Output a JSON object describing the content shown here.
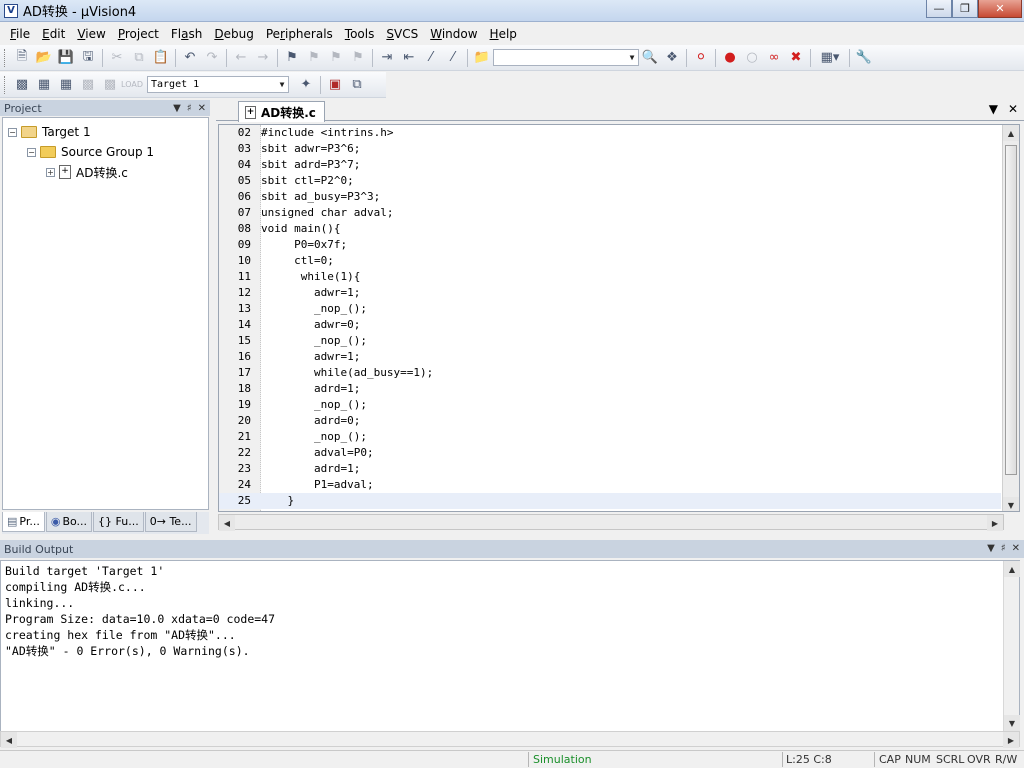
{
  "window": {
    "title": "AD转换 - µVision4",
    "app_icon": "uvision-icon"
  },
  "menu": [
    {
      "label": "File",
      "underline": "F"
    },
    {
      "label": "Edit",
      "underline": "E"
    },
    {
      "label": "View",
      "underline": "V"
    },
    {
      "label": "Project",
      "underline": "P"
    },
    {
      "label": "Flash",
      "underline": "a"
    },
    {
      "label": "Debug",
      "underline": "D"
    },
    {
      "label": "Peripherals",
      "underline": "r"
    },
    {
      "label": "Tools",
      "underline": "T"
    },
    {
      "label": "SVCS",
      "underline": "S"
    },
    {
      "label": "Window",
      "underline": "W"
    },
    {
      "label": "Help",
      "underline": "H"
    }
  ],
  "toolbar2": {
    "target_select": "Target 1"
  },
  "project_panel": {
    "title": "Project",
    "tree": {
      "target": "Target 1",
      "group": "Source Group 1",
      "file": "AD转换.c"
    },
    "tabs": [
      "Pr...",
      "Bo...",
      "{} Fu...",
      "0→ Te..."
    ]
  },
  "editor": {
    "tab_label": "AD转换.c",
    "lines": [
      {
        "num": "02",
        "text": "#include <intrins.h>"
      },
      {
        "num": "03",
        "text": "sbit adwr=P3^6;"
      },
      {
        "num": "04",
        "text": "sbit adrd=P3^7;"
      },
      {
        "num": "05",
        "text": "sbit ctl=P2^0;"
      },
      {
        "num": "06",
        "text": "sbit ad_busy=P3^3;"
      },
      {
        "num": "07",
        "text": "unsigned char adval;"
      },
      {
        "num": "08",
        "text": "void main(){"
      },
      {
        "num": "09",
        "text": "     P0=0x7f;"
      },
      {
        "num": "10",
        "text": "     ctl=0;"
      },
      {
        "num": "11",
        "text": "      while(1){"
      },
      {
        "num": "12",
        "text": "        adwr=1;"
      },
      {
        "num": "13",
        "text": "        _nop_();"
      },
      {
        "num": "14",
        "text": "        adwr=0;"
      },
      {
        "num": "15",
        "text": "        _nop_();"
      },
      {
        "num": "16",
        "text": "        adwr=1;"
      },
      {
        "num": "17",
        "text": "        while(ad_busy==1);"
      },
      {
        "num": "18",
        "text": "        adrd=1;"
      },
      {
        "num": "19",
        "text": "        _nop_();"
      },
      {
        "num": "20",
        "text": "        adrd=0;"
      },
      {
        "num": "21",
        "text": "        _nop_();"
      },
      {
        "num": "22",
        "text": "        adval=P0;"
      },
      {
        "num": "23",
        "text": "        adrd=1;"
      },
      {
        "num": "24",
        "text": "        P1=adval;"
      },
      {
        "num": "25",
        "text": "    }"
      }
    ],
    "current_line": "25"
  },
  "build_output": {
    "title": "Build Output",
    "lines": [
      "Build target 'Target 1'",
      "compiling AD转换.c...",
      "linking...",
      "Program Size: data=10.0 xdata=0 code=47",
      "creating hex file from \"AD转换\"...",
      "\"AD转换\" - 0 Error(s), 0 Warning(s)."
    ]
  },
  "status": {
    "mode": "Simulation",
    "position": "L:25 C:8",
    "cap": "CAP",
    "num": "NUM",
    "scrl": "SCRL",
    "ovr": "OVR",
    "rw": "R/W"
  },
  "colors": {
    "simulation": "#1a8f2a",
    "breakpoint": "#d21e1e"
  }
}
